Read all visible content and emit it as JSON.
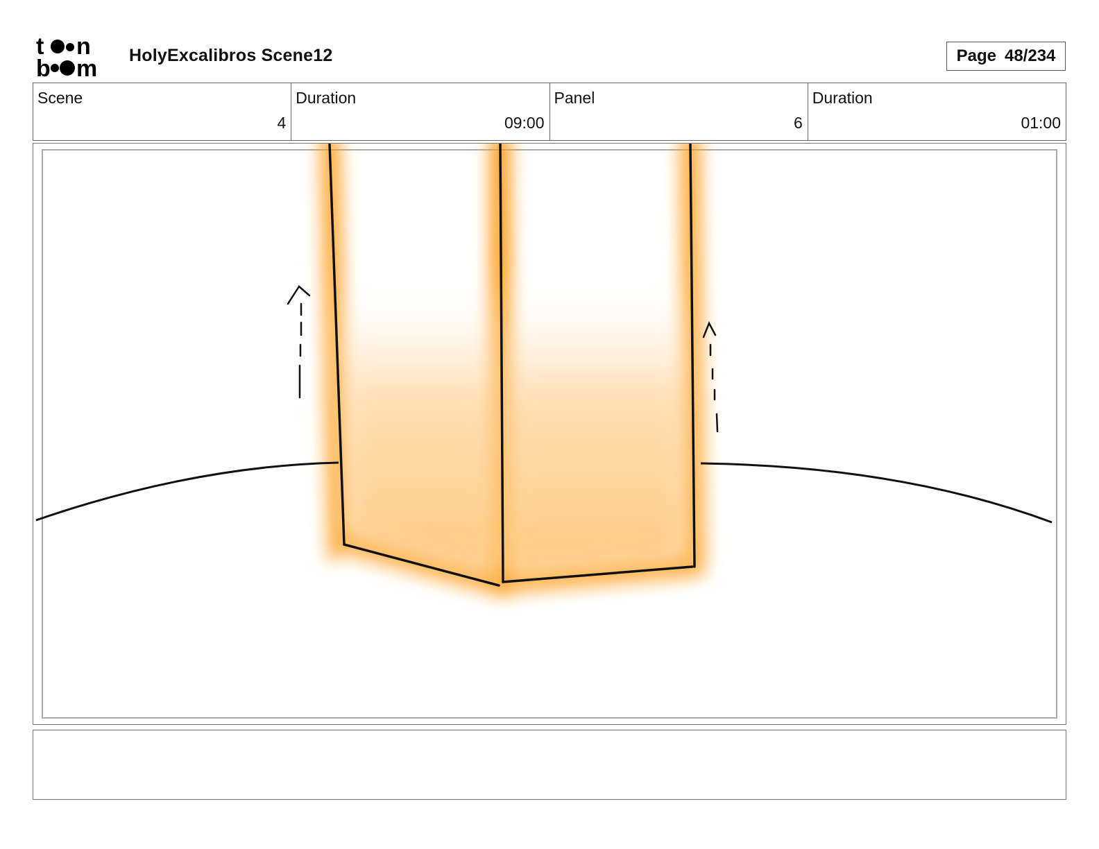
{
  "header": {
    "logo_line1": "toon",
    "logo_line2": "boom",
    "project_title": "HolyExcalibros Scene12",
    "page_label": "Page",
    "page_number": "48/234"
  },
  "info": [
    {
      "label": "Scene",
      "value": "4"
    },
    {
      "label": "Duration",
      "value": "09:00"
    },
    {
      "label": "Panel",
      "value": "6"
    },
    {
      "label": "Duration",
      "value": "01:00"
    }
  ],
  "panel": {
    "glow_color": "#ff9e1f",
    "fill_color": "#ffd39a",
    "ink_color": "#111111"
  },
  "notes": {
    "text": ""
  }
}
